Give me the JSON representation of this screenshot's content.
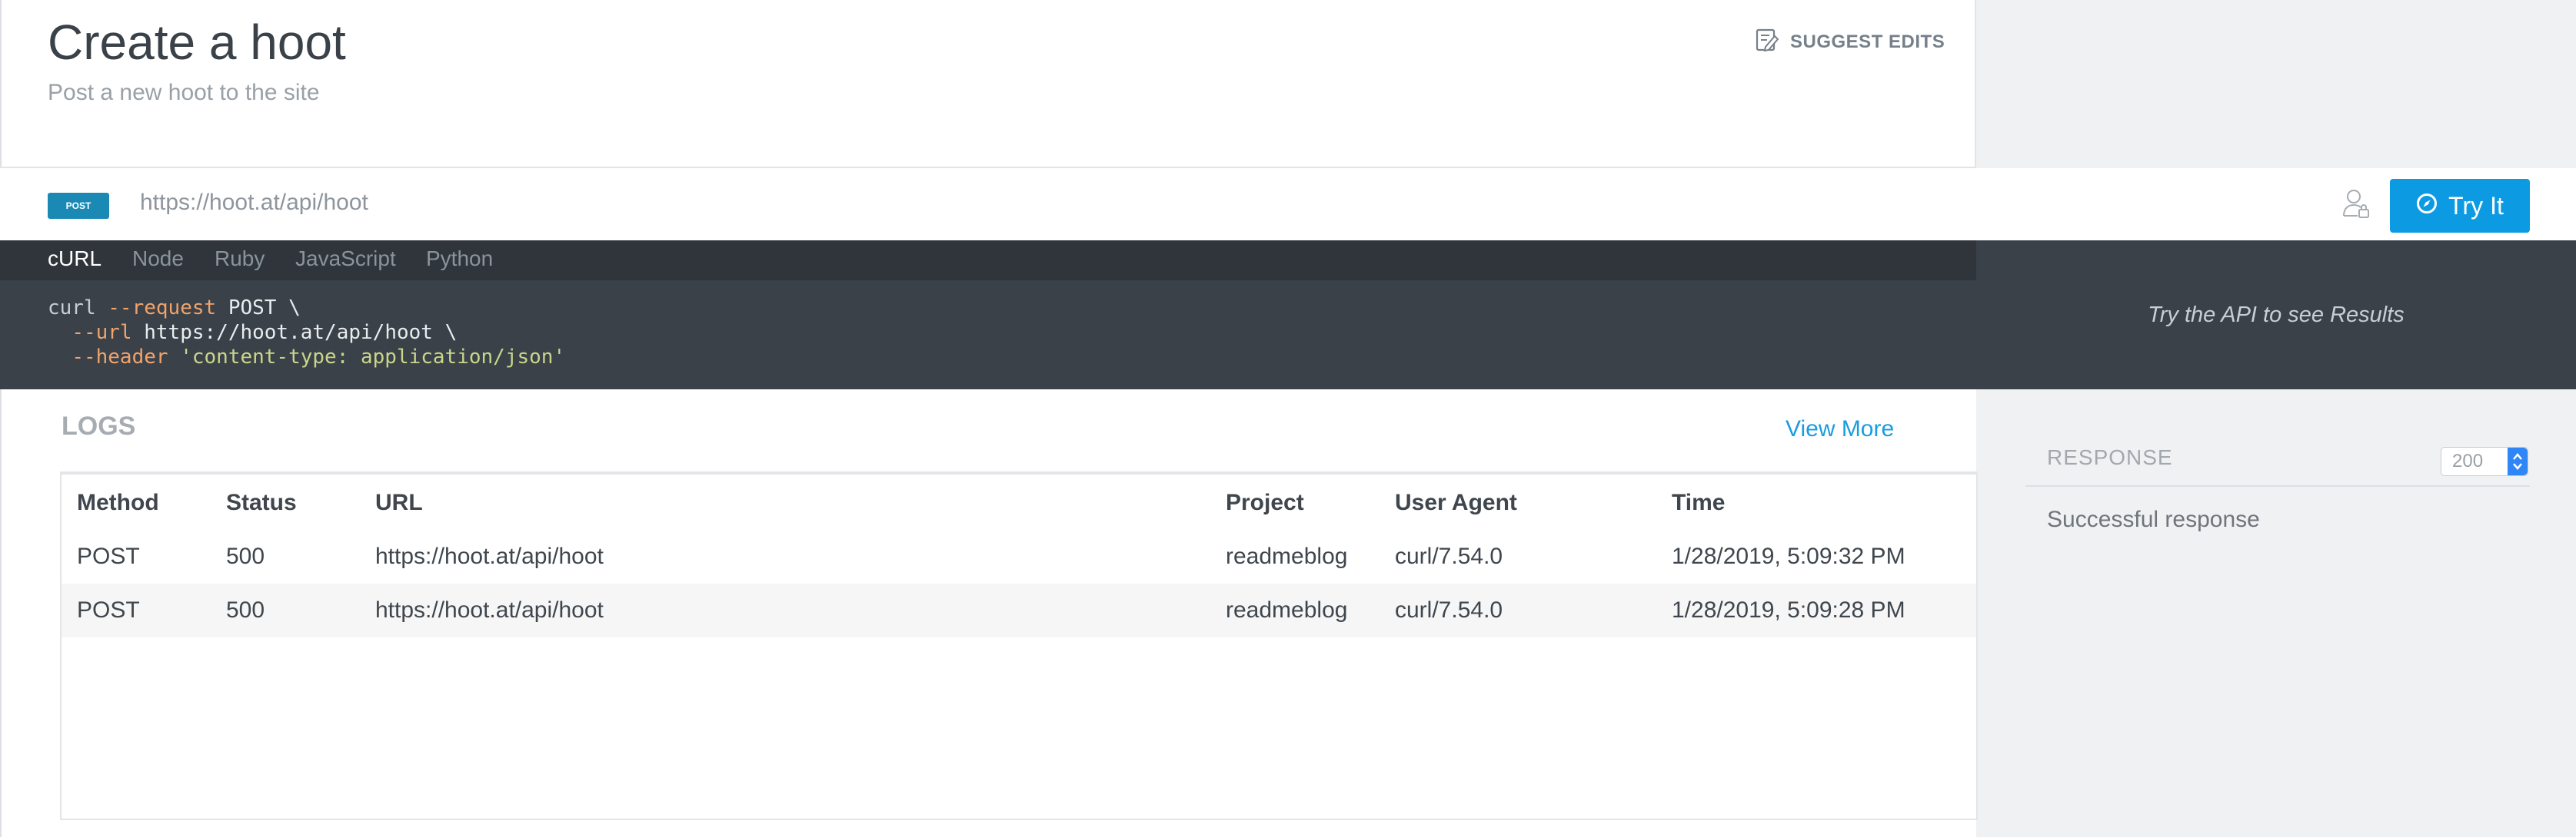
{
  "header": {
    "title": "Create a hoot",
    "subtitle": "Post a new hoot to the site",
    "suggest_edits_label": "SUGGEST EDITS"
  },
  "endpoint": {
    "method": "POST",
    "url": "https://hoot.at/api/hoot",
    "try_it_label": "Try It"
  },
  "code": {
    "tabs": [
      "cURL",
      "Node",
      "Ruby",
      "JavaScript",
      "Python"
    ],
    "active_tab": "cURL",
    "lines": [
      [
        {
          "t": "curl ",
          "k": "cmd"
        },
        {
          "t": "--request",
          "k": "flag"
        },
        {
          "t": " POST \\",
          "k": "plain"
        }
      ],
      [
        {
          "t": "  ",
          "k": "plain"
        },
        {
          "t": "--url",
          "k": "flag"
        },
        {
          "t": " https://hoot.at/api/hoot \\",
          "k": "plain"
        }
      ],
      [
        {
          "t": "  ",
          "k": "plain"
        },
        {
          "t": "--header",
          "k": "flag"
        },
        {
          "t": " 'content-type: application/json'",
          "k": "str"
        }
      ]
    ],
    "results_placeholder": "Try the API to see Results"
  },
  "logs": {
    "heading": "LOGS",
    "view_more_label": "View More",
    "columns": [
      "Method",
      "Status",
      "URL",
      "Project",
      "User Agent",
      "Time"
    ],
    "rows": [
      [
        "POST",
        "500",
        "https://hoot.at/api/hoot",
        "readmeblog",
        "curl/7.54.0",
        "1/28/2019, 5:09:32 PM"
      ],
      [
        "POST",
        "500",
        "https://hoot.at/api/hoot",
        "readmeblog",
        "curl/7.54.0",
        "1/28/2019, 5:09:28 PM"
      ]
    ]
  },
  "response": {
    "label": "RESPONSE",
    "status_selected": "200",
    "description": "Successful response"
  },
  "colors": {
    "accent": "#0c9be3",
    "method_post": "#1a8ab5",
    "code_bg": "#3b4148",
    "code_tabs_bg": "#2f353b",
    "side_panel_bg": "#f0f1f3"
  },
  "icons": {
    "suggest_edits": "edit-note-icon",
    "auth": "user-lock-icon",
    "try_it": "compass-icon",
    "select_arrows": "updown-chevron-icon"
  }
}
